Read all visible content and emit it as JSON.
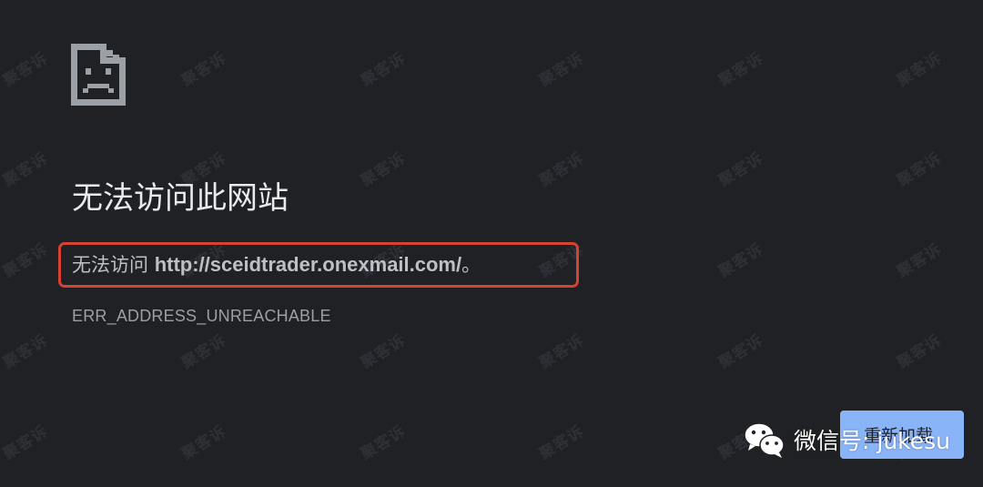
{
  "error_page": {
    "title": "无法访问此网站",
    "message_prefix": "无法访问",
    "message_url": "http://sceidtrader.onexmail.com/",
    "message_suffix": "。",
    "error_code": "ERR_ADDRESS_UNREACHABLE",
    "reload_label": "重新加载",
    "icon": "sad-page-icon"
  },
  "overlay": {
    "wechat_label": "微信号: jukesu",
    "icon": "wechat-icon"
  },
  "watermark": {
    "text": "聚客诉"
  },
  "colors": {
    "background": "#202124",
    "title": "#e8eaed",
    "text": "#bdc1c6",
    "error_code": "#9aa0a6",
    "button": "#8ab4f8",
    "highlight_border": "#d8412f"
  }
}
